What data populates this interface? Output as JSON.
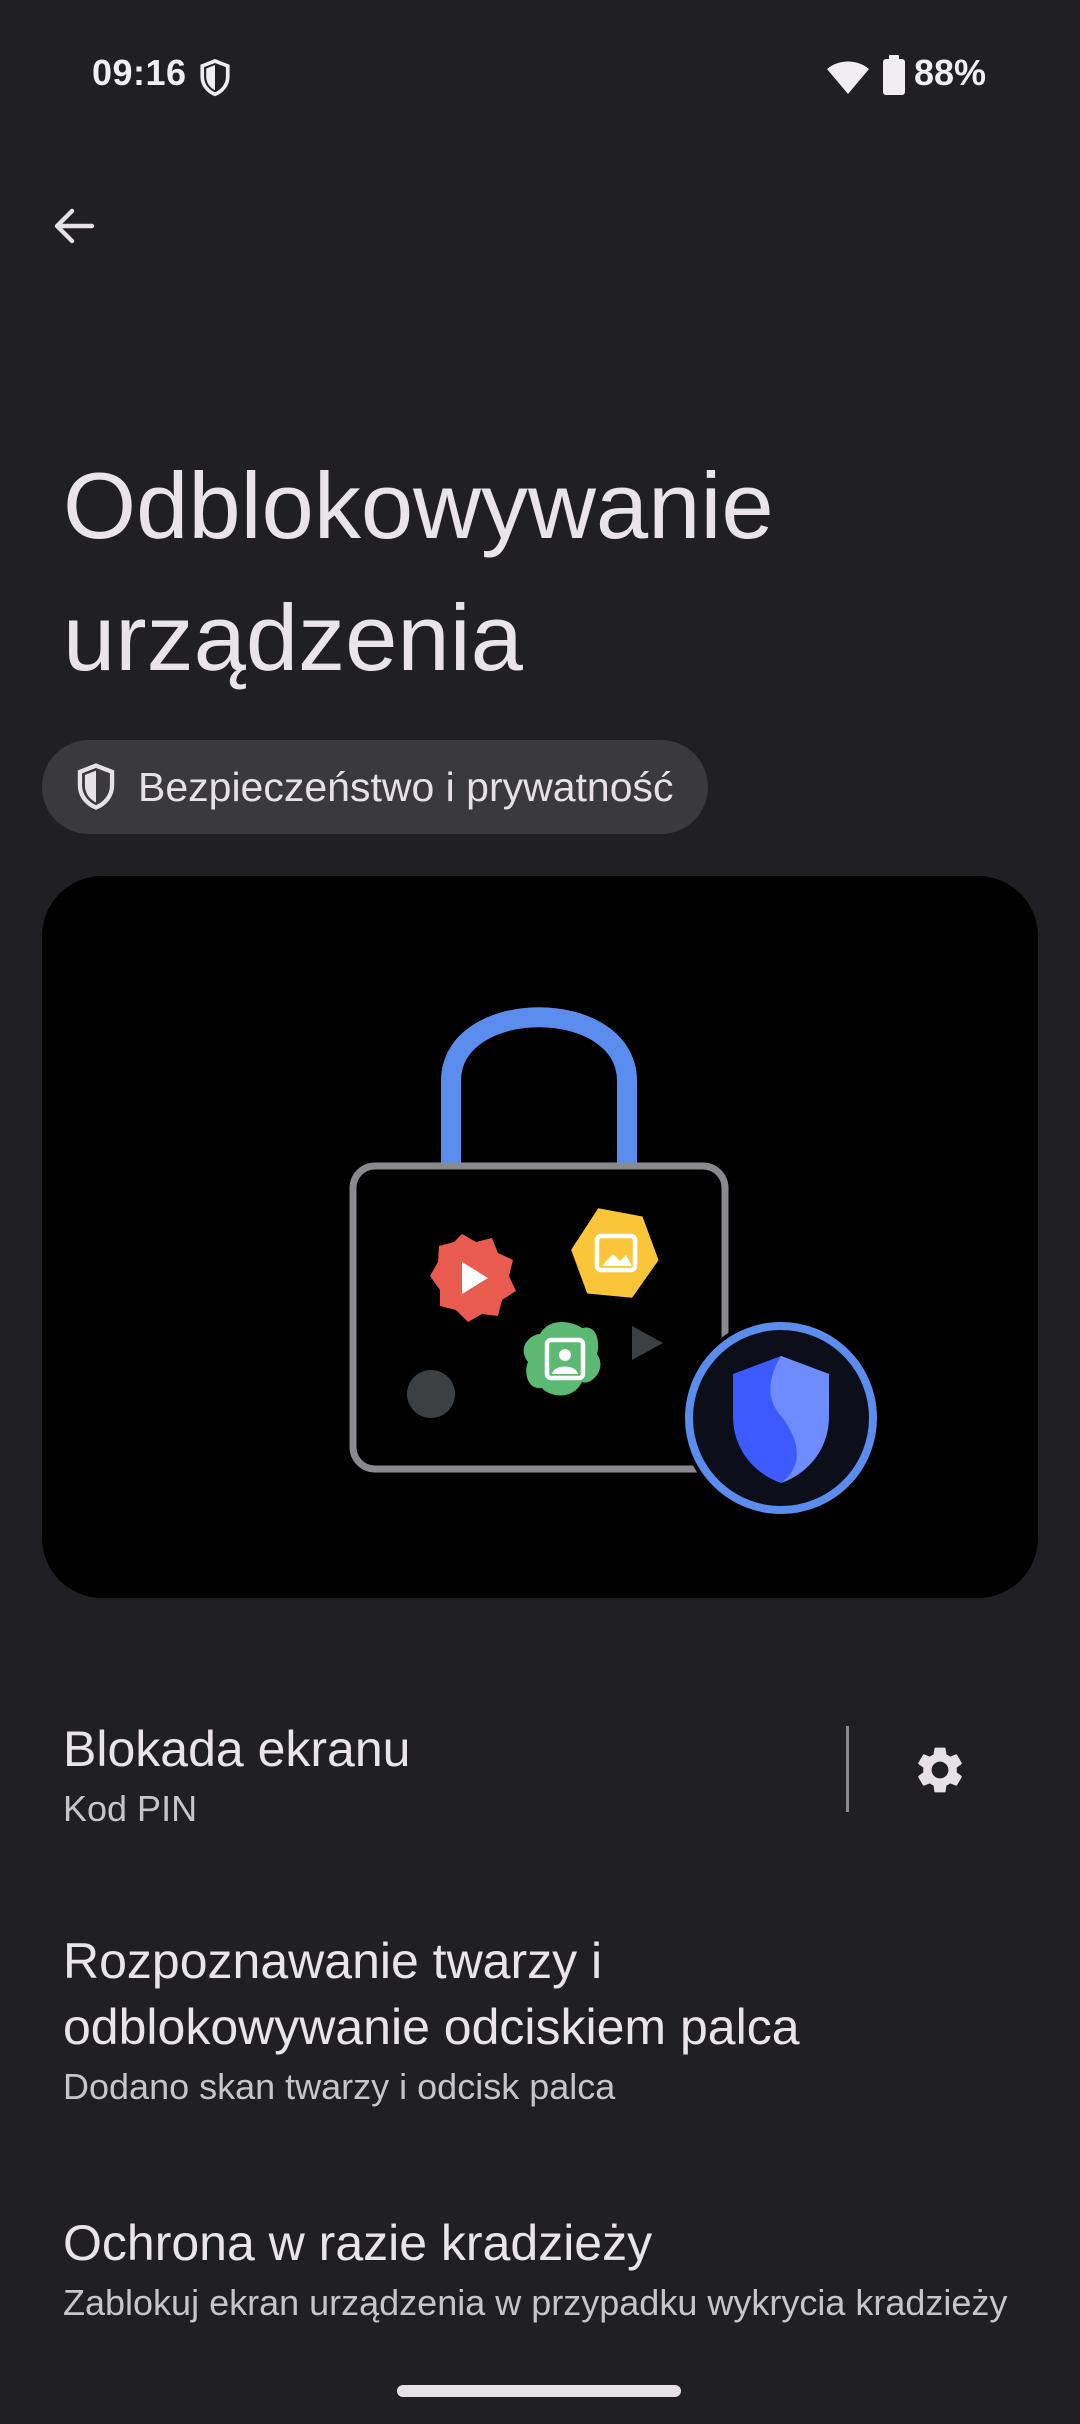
{
  "status_bar": {
    "time": "09:16",
    "battery_percent": "88%",
    "icons": [
      "shield-icon",
      "wifi-icon",
      "battery-icon"
    ]
  },
  "header": {
    "back_icon": "arrow-back-icon"
  },
  "page": {
    "title": "Odblokowywanie urządzenia",
    "breadcrumb": {
      "icon": "shield-icon",
      "label": "Bezpieczeństwo i prywatność"
    }
  },
  "illustration": {
    "description_icons": [
      "padlock-icon",
      "play-icon",
      "image-icon",
      "contact-icon",
      "shield-icon"
    ]
  },
  "settings": {
    "items": [
      {
        "title": "Blokada ekranu",
        "subtitle": "Kod PIN",
        "action_icon": "gear-icon"
      },
      {
        "title": "Rozpoznawanie twarzy i odblokowywanie odciskiem palca",
        "subtitle": "Dodano skan twarzy i odcisk palca"
      },
      {
        "title": "Ochrona w razie kradzieży",
        "subtitle": "Zablokuj ekran urządzenia w przypadku wykrycia kradzieży"
      }
    ]
  },
  "colors": {
    "background": "#202024",
    "chip_bg": "#3a393e",
    "accent_blue": "#5b8def",
    "shield_blue": "#3d5afe",
    "red_badge": "#ea5b4f",
    "yellow_badge": "#fbc53a",
    "green_badge": "#5bb974"
  }
}
